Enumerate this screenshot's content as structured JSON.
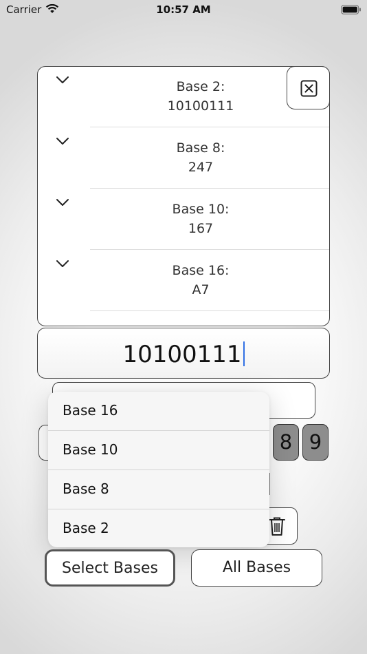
{
  "status_bar": {
    "carrier": "Carrier",
    "time": "10:57 AM",
    "wifi_icon": "wifi-icon",
    "battery_icon": "battery-icon"
  },
  "results": [
    {
      "label": "Base 2:",
      "value": "10100111"
    },
    {
      "label": "Base 8:",
      "value": "247"
    },
    {
      "label": "Base 10:",
      "value": "167"
    },
    {
      "label": "Base 16:",
      "value": "A7"
    }
  ],
  "close_icon": "close-square-icon",
  "input": {
    "value": "10100111"
  },
  "keypad": {
    "digits": [
      "8",
      "9"
    ]
  },
  "delete_icon": "trash-icon",
  "bases_menu": {
    "items": [
      "Base 16",
      "Base 10",
      "Base 8",
      "Base 2"
    ]
  },
  "buttons": {
    "select_bases": "Select Bases",
    "all_bases": "All Bases"
  },
  "colors": {
    "caret": "#2f6fe4",
    "digit_key": "#8d8d8d"
  }
}
